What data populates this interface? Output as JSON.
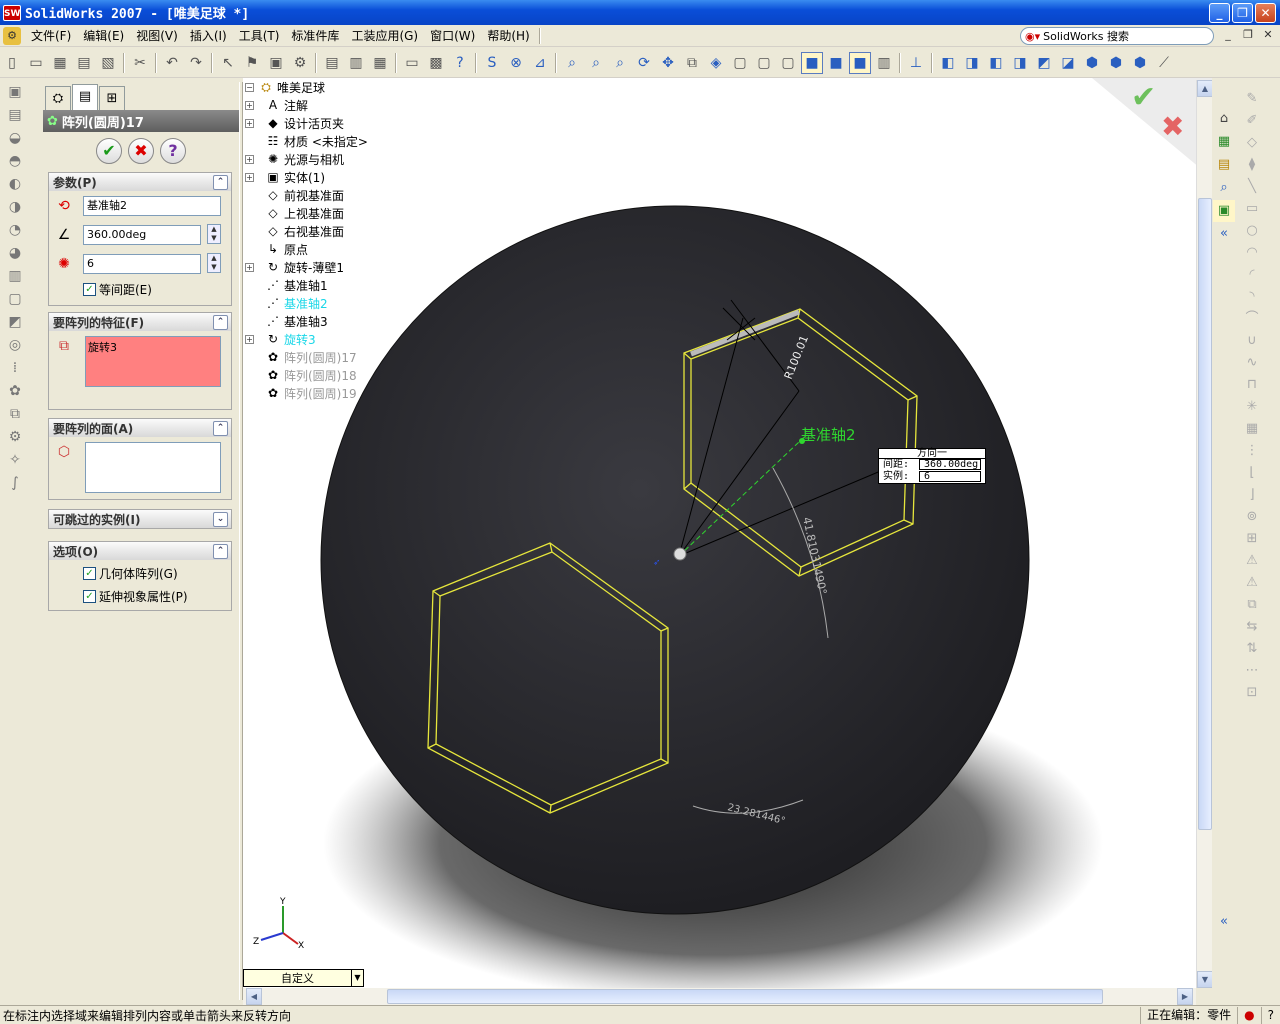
{
  "window": {
    "title": "SolidWorks 2007 - [唯美足球 *]",
    "logo": "SW",
    "min": "_",
    "restore": "❐",
    "close": "✕"
  },
  "menu": {
    "items": [
      "文件(F)",
      "编辑(E)",
      "视图(V)",
      "插入(I)",
      "工具(T)",
      "标准件库",
      "工装应用(G)",
      "窗口(W)",
      "帮助(H)"
    ],
    "search_label": "SolidWorks 搜索",
    "mdi_min": "_",
    "mdi_restore": "❐",
    "mdi_close": "✕"
  },
  "property_manager": {
    "title": "阵列(圆周)17",
    "buttons": {
      "ok": "✔",
      "cancel": "✖",
      "help": "?"
    },
    "params": {
      "header": "参数(P)",
      "axis": "基准轴2",
      "angle": "360.00deg",
      "instances": "6",
      "equal_spacing": "等间距(E)"
    },
    "features": {
      "header": "要阵列的特征(F)",
      "item": "旋转3"
    },
    "faces": {
      "header": "要阵列的面(A)"
    },
    "skip": {
      "header": "可跳过的实例(I)"
    },
    "options": {
      "header": "选项(O)",
      "geometry": "几何体阵列(G)",
      "propagate": "延伸视象属性(P)"
    }
  },
  "tree": {
    "root": "唯美足球",
    "items": [
      {
        "label": "注解",
        "expand": "+",
        "icon": "A"
      },
      {
        "label": "设计活页夹",
        "expand": "+",
        "icon": "◆"
      },
      {
        "label": "材质 <未指定>",
        "expand": "",
        "icon": "☷"
      },
      {
        "label": "光源与相机",
        "expand": "+",
        "icon": "✺"
      },
      {
        "label": "实体(1)",
        "expand": "+",
        "icon": "▣"
      },
      {
        "label": "前视基准面",
        "expand": "",
        "icon": "◇"
      },
      {
        "label": "上视基准面",
        "expand": "",
        "icon": "◇"
      },
      {
        "label": "右视基准面",
        "expand": "",
        "icon": "◇"
      },
      {
        "label": "原点",
        "expand": "",
        "icon": "↳"
      },
      {
        "label": "旋转-薄壁1",
        "expand": "+",
        "icon": "↻"
      },
      {
        "label": "基准轴1",
        "expand": "",
        "icon": "⋰"
      },
      {
        "label": "基准轴2",
        "expand": "",
        "icon": "⋰",
        "style": "cyan"
      },
      {
        "label": "基准轴3",
        "expand": "",
        "icon": "⋰"
      },
      {
        "label": "旋转3",
        "expand": "+",
        "icon": "↻",
        "style": "cyan"
      },
      {
        "label": "阵列(圆周)17",
        "expand": "",
        "icon": "✿",
        "style": "gray"
      },
      {
        "label": "阵列(圆周)18",
        "expand": "",
        "icon": "✿",
        "style": "gray"
      },
      {
        "label": "阵列(圆周)19",
        "expand": "",
        "icon": "✿",
        "style": "gray"
      }
    ]
  },
  "graphics": {
    "axis_label": "基准轴2",
    "radius_dim": "R100.01",
    "angle_dim_1": "41.81031490°",
    "angle_dim_2": "23.281446°",
    "callout": {
      "title": "方向一",
      "spacing_label": "间距:",
      "spacing_value": "360.00deg",
      "instances_label": "实例:",
      "instances_value": "6"
    },
    "triad_x": "X",
    "triad_y": "Y",
    "triad_z": "Z",
    "colors": {
      "sphere": "#2a2a30",
      "hexagon": "#e6e63c",
      "axis": "#2fd62f",
      "ok": "#6dc05c",
      "cancel": "#e46464"
    }
  },
  "view_selector": "自定义",
  "status": {
    "message": "在标注内选择域来编辑排列内容或单击箭头来反转方向",
    "mode": "正在编辑：零件"
  }
}
